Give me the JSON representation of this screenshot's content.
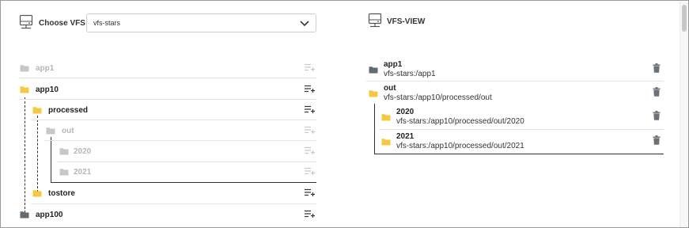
{
  "left_panel": {
    "label": "Choose VFS",
    "header_icon": "network-drive-icon",
    "select_value": "vfs-stars",
    "select_icon": "chevron-down-icon"
  },
  "tree": {
    "add_icon": "playlist-add-icon",
    "folder_icon": "folder-icon",
    "items": [
      {
        "name": "app1",
        "state": "disabled"
      },
      {
        "name": "app10",
        "state": "open"
      },
      {
        "name": "processed",
        "state": "open"
      },
      {
        "name": "out",
        "state": "disabled"
      },
      {
        "name": "2020",
        "state": "disabled"
      },
      {
        "name": "2021",
        "state": "disabled"
      },
      {
        "name": "tostore",
        "state": "open"
      },
      {
        "name": "app100",
        "state": "closed"
      }
    ]
  },
  "right_panel": {
    "label": "VFS-VIEW",
    "header_icon": "network-drive-icon",
    "delete_icon": "trash-icon",
    "items": [
      {
        "name": "app1",
        "path": "vfs-stars:/app1"
      },
      {
        "name": "out",
        "path": "vfs-stars:/app10/processed/out"
      },
      {
        "name": "2020",
        "path": "vfs-stars:/app10/processed/out/2020"
      },
      {
        "name": "2021",
        "path": "vfs-stars:/app10/processed/out/2021"
      }
    ]
  },
  "colors": {
    "folder_yellow": "#f5c842",
    "folder_dark": "#5f6b75",
    "folder_muted": "#c3c8cd",
    "text_muted": "#b3b8bd",
    "line": "#333333"
  }
}
